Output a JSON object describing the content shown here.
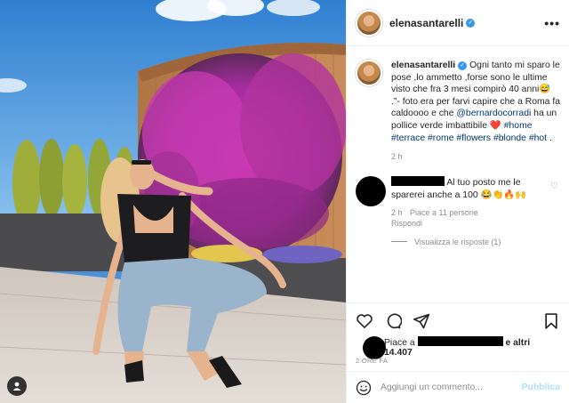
{
  "colors": {
    "accent": "#3897f0",
    "link": "#00376b",
    "muted": "#8e8e8e",
    "publish_disabled": "#b2dffc",
    "heart": "#e0245e"
  },
  "post": {
    "username": "elenasantarelli",
    "caption_parts": [
      {
        "text": " Ogni tanto mi sparo le pose ,lo ammetto ,forse sono le ultime visto che fra 3 mesi compirò 40 anni😅 .”- foto era per farvi capire che a Roma fa caldoooo e che ",
        "type": "text"
      },
      {
        "text": "@bernardocorradi",
        "type": "link"
      },
      {
        "text": " ha un pollice verde imbattibile ",
        "type": "text"
      },
      {
        "text": "❤️",
        "type": "heart"
      },
      {
        "text": " ",
        "type": "text"
      },
      {
        "text": "#home",
        "type": "link"
      },
      {
        "text": " ",
        "type": "text"
      },
      {
        "text": "#terrace",
        "type": "link"
      },
      {
        "text": " ",
        "type": "text"
      },
      {
        "text": "#rome",
        "type": "link"
      },
      {
        "text": " ",
        "type": "text"
      },
      {
        "text": "#flowers",
        "type": "link"
      },
      {
        "text": " ",
        "type": "text"
      },
      {
        "text": "#blonde",
        "type": "link"
      },
      {
        "text": " ",
        "type": "text"
      },
      {
        "text": "#hot",
        "type": "link"
      },
      {
        "text": " .",
        "type": "text"
      }
    ],
    "caption_time": "2 h"
  },
  "reply": {
    "text": "Al tuo posto me le sparerei anche a 100 😂👏🔥🙌",
    "time": "2 h",
    "likes": "Piace a 11 persone",
    "reply_label": "Rispondi",
    "view_replies": "Visualizza le risposte (1)"
  },
  "actions": {
    "likes_prefix": "Piace a",
    "likes_suffix": "e altri 14.407",
    "date": "2 ORE FA"
  },
  "comment_box": {
    "placeholder": "Aggiungi un commento...",
    "publish": "Pubblica"
  },
  "icons": [
    "verified-badge-icon",
    "more-options-icon",
    "heart-icon",
    "comment-icon",
    "share-icon",
    "save-icon",
    "emoji-icon",
    "user-tag-icon"
  ]
}
